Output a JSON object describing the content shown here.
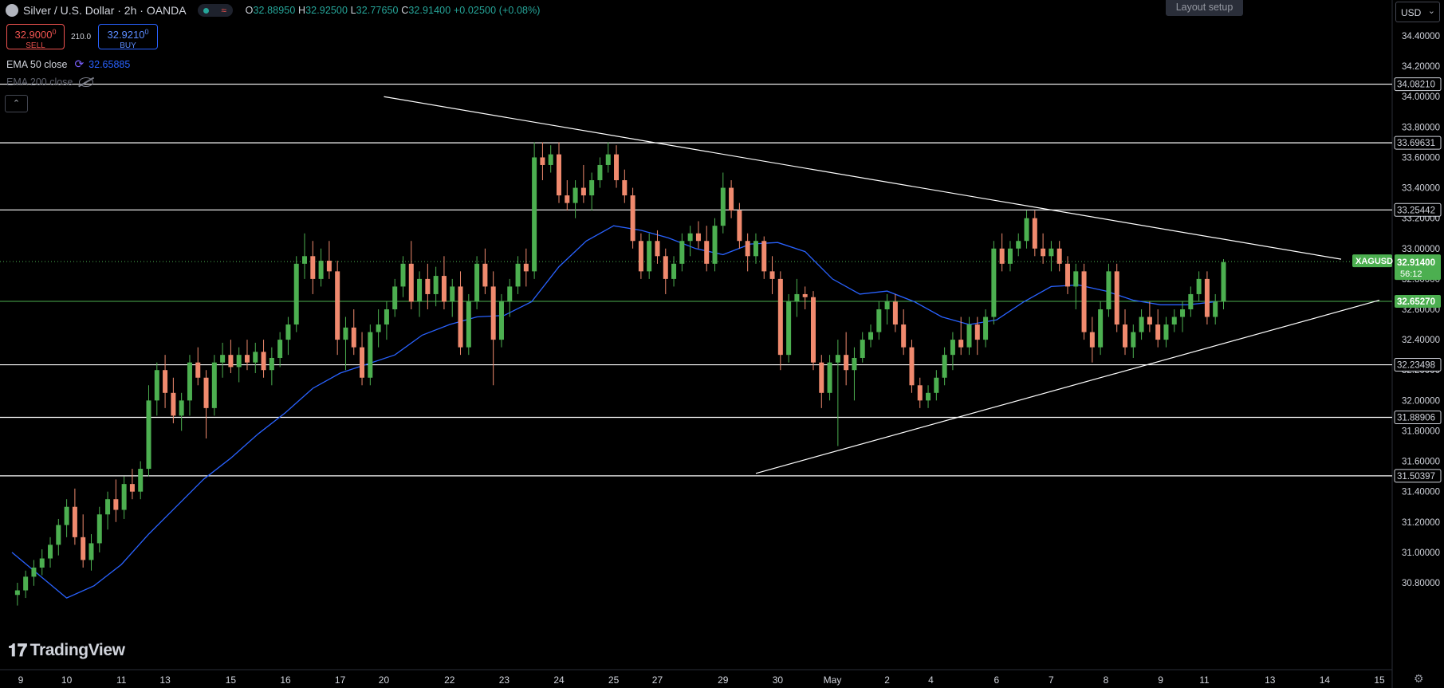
{
  "header": {
    "symbol": "Silver / U.S. Dollar · 2h · OANDA",
    "ohlc": {
      "o": "32.88950",
      "h": "32.92500",
      "l": "32.77650",
      "c": "32.91400",
      "change": "+0.02500 (+0.08%)"
    }
  },
  "trade": {
    "sell_price": "32.9000",
    "sell_sup": "0",
    "sell_label": "SELL",
    "spread": "210.0",
    "buy_price": "32.9210",
    "buy_sup": "0",
    "buy_label": "BUY"
  },
  "indicators": {
    "ema50_label": "EMA 50 close",
    "ema50_value": "32.65885",
    "ema200_label": "EMA 200 close"
  },
  "toolbar": {
    "layout_setup": "Layout setup",
    "currency": "USD"
  },
  "branding": {
    "name": "TradingView"
  },
  "colors": {
    "up": "#26a69a",
    "up_candle": "#4caf50",
    "down": "#ef5350",
    "down_candle": "#f08a6e",
    "ema": "#2962ff",
    "background": "#000000",
    "line": "#ffffff"
  },
  "chart_data": {
    "type": "candlestick",
    "ylim": [
      30.72,
      34.55
    ],
    "y_ticks": [
      "34.40000",
      "34.20000",
      "34.00000",
      "33.80000",
      "33.60000",
      "33.40000",
      "33.20000",
      "33.00000",
      "32.80000",
      "32.60000",
      "32.40000",
      "32.20000",
      "32.00000",
      "31.80000",
      "31.60000",
      "31.40000",
      "31.20000",
      "31.00000",
      "30.80000"
    ],
    "x_ticks": [
      {
        "label": "9",
        "x": 0.16
      },
      {
        "label": "10",
        "x": 1
      },
      {
        "label": "11",
        "x": 2
      },
      {
        "label": "13",
        "x": 2.8
      },
      {
        "label": "15",
        "x": 4
      },
      {
        "label": "16",
        "x": 5
      },
      {
        "label": "17",
        "x": 6
      },
      {
        "label": "20",
        "x": 6.8
      },
      {
        "label": "22",
        "x": 8
      },
      {
        "label": "23",
        "x": 9
      },
      {
        "label": "24",
        "x": 10
      },
      {
        "label": "25",
        "x": 11
      },
      {
        "label": "27",
        "x": 11.8
      },
      {
        "label": "29",
        "x": 13
      },
      {
        "label": "30",
        "x": 14
      },
      {
        "label": "May",
        "x": 15
      },
      {
        "label": "2",
        "x": 16
      },
      {
        "label": "4",
        "x": 16.8
      },
      {
        "label": "6",
        "x": 18
      },
      {
        "label": "7",
        "x": 19
      },
      {
        "label": "8",
        "x": 20
      },
      {
        "label": "9",
        "x": 21
      },
      {
        "label": "11",
        "x": 21.8
      },
      {
        "label": "13",
        "x": 23
      },
      {
        "label": "14",
        "x": 24
      },
      {
        "label": "15",
        "x": 25
      }
    ],
    "horizontal_levels": [
      {
        "value": 34.0821,
        "label": "34.08210"
      },
      {
        "value": 33.69631,
        "label": "33.69631"
      },
      {
        "value": 33.25442,
        "label": "33.25442"
      },
      {
        "value": 32.23498,
        "label": "32.23498"
      },
      {
        "value": 31.88906,
        "label": "31.88906"
      },
      {
        "value": 31.50397,
        "label": "31.50397"
      }
    ],
    "support_level": {
      "value": 32.6527,
      "label": "32.65270"
    },
    "current_price": {
      "symbol": "XAGUSD",
      "value": 32.914,
      "label": "32.91400",
      "countdown": "56:12"
    },
    "trendlines": [
      {
        "x1": 6.8,
        "y1": 34.0,
        "x2": 24.3,
        "y2": 32.93
      },
      {
        "x1": 13.6,
        "y1": 31.52,
        "x2": 25.0,
        "y2": 32.66
      }
    ],
    "ema50": [
      [
        0,
        31.0
      ],
      [
        0.5,
        30.85
      ],
      [
        1.0,
        30.7
      ],
      [
        1.5,
        30.78
      ],
      [
        2.0,
        30.92
      ],
      [
        2.5,
        31.12
      ],
      [
        3.0,
        31.3
      ],
      [
        3.5,
        31.48
      ],
      [
        4.0,
        31.62
      ],
      [
        4.5,
        31.78
      ],
      [
        5.0,
        31.92
      ],
      [
        5.5,
        32.08
      ],
      [
        6.0,
        32.18
      ],
      [
        6.5,
        32.24
      ],
      [
        7.0,
        32.3
      ],
      [
        7.5,
        32.43
      ],
      [
        8.0,
        32.5
      ],
      [
        8.5,
        32.55
      ],
      [
        9.0,
        32.56
      ],
      [
        9.5,
        32.65
      ],
      [
        10.0,
        32.88
      ],
      [
        10.5,
        33.05
      ],
      [
        11.0,
        33.15
      ],
      [
        11.5,
        33.12
      ],
      [
        12.0,
        33.07
      ],
      [
        12.5,
        33.0
      ],
      [
        13.0,
        32.96
      ],
      [
        13.5,
        33.03
      ],
      [
        14.0,
        33.04
      ],
      [
        14.5,
        32.98
      ],
      [
        15.0,
        32.8
      ],
      [
        15.5,
        32.7
      ],
      [
        16.0,
        32.72
      ],
      [
        16.5,
        32.65
      ],
      [
        17.0,
        32.55
      ],
      [
        17.5,
        32.5
      ],
      [
        18.0,
        32.53
      ],
      [
        18.5,
        32.65
      ],
      [
        19.0,
        32.75
      ],
      [
        19.5,
        32.76
      ],
      [
        20.0,
        32.72
      ],
      [
        20.5,
        32.66
      ],
      [
        21.0,
        32.63
      ],
      [
        21.5,
        32.63
      ],
      [
        22.0,
        32.65
      ]
    ],
    "candles": [
      [
        0.1,
        30.72,
        30.8,
        30.65,
        30.75
      ],
      [
        0.25,
        30.75,
        30.88,
        30.7,
        30.84
      ],
      [
        0.4,
        30.84,
        30.95,
        30.78,
        30.9
      ],
      [
        0.55,
        30.9,
        31.02,
        30.85,
        30.96
      ],
      [
        0.7,
        30.96,
        31.1,
        30.9,
        31.05
      ],
      [
        0.85,
        31.05,
        31.22,
        30.98,
        31.18
      ],
      [
        1.0,
        31.18,
        31.35,
        31.1,
        31.3
      ],
      [
        1.15,
        31.3,
        31.42,
        31.05,
        31.1
      ],
      [
        1.3,
        31.1,
        31.25,
        30.9,
        30.95
      ],
      [
        1.45,
        30.95,
        31.12,
        30.88,
        31.06
      ],
      [
        1.6,
        31.06,
        31.3,
        31.0,
        31.25
      ],
      [
        1.75,
        31.25,
        31.4,
        31.15,
        31.35
      ],
      [
        1.9,
        31.35,
        31.48,
        31.2,
        31.28
      ],
      [
        2.05,
        31.28,
        31.5,
        31.22,
        31.45
      ],
      [
        2.2,
        31.45,
        31.55,
        31.35,
        31.4
      ],
      [
        2.35,
        31.4,
        31.6,
        31.35,
        31.55
      ],
      [
        2.5,
        31.55,
        32.1,
        31.5,
        32.0
      ],
      [
        2.65,
        32.0,
        32.25,
        31.9,
        32.2
      ],
      [
        2.8,
        32.2,
        32.3,
        31.95,
        32.05
      ],
      [
        2.95,
        32.05,
        32.15,
        31.85,
        31.9
      ],
      [
        3.1,
        31.9,
        32.05,
        31.8,
        32.0
      ],
      [
        3.25,
        32.0,
        32.3,
        31.9,
        32.25
      ],
      [
        3.4,
        32.25,
        32.35,
        32.1,
        32.15
      ],
      [
        3.55,
        32.15,
        32.2,
        31.75,
        31.95
      ],
      [
        3.7,
        31.95,
        32.3,
        31.9,
        32.25
      ],
      [
        3.85,
        32.25,
        32.38,
        32.15,
        32.3
      ],
      [
        4.0,
        32.3,
        32.4,
        32.18,
        32.22
      ],
      [
        4.15,
        32.22,
        32.35,
        32.12,
        32.3
      ],
      [
        4.3,
        32.3,
        32.4,
        32.2,
        32.25
      ],
      [
        4.45,
        32.25,
        32.38,
        32.18,
        32.32
      ],
      [
        4.6,
        32.32,
        32.4,
        32.15,
        32.2
      ],
      [
        4.75,
        32.2,
        32.35,
        32.1,
        32.28
      ],
      [
        4.9,
        32.28,
        32.45,
        32.22,
        32.4
      ],
      [
        5.05,
        32.4,
        32.55,
        32.3,
        32.5
      ],
      [
        5.2,
        32.5,
        32.95,
        32.45,
        32.9
      ],
      [
        5.35,
        32.9,
        33.1,
        32.8,
        32.95
      ],
      [
        5.5,
        32.95,
        33.05,
        32.7,
        32.8
      ],
      [
        5.65,
        32.8,
        33.0,
        32.75,
        32.92
      ],
      [
        5.8,
        32.92,
        33.05,
        32.8,
        32.85
      ],
      [
        5.95,
        32.85,
        32.92,
        32.3,
        32.4
      ],
      [
        6.1,
        32.4,
        32.55,
        32.2,
        32.48
      ],
      [
        6.25,
        32.48,
        32.6,
        32.3,
        32.35
      ],
      [
        6.4,
        32.35,
        32.45,
        32.1,
        32.15
      ],
      [
        6.55,
        32.15,
        32.5,
        32.1,
        32.45
      ],
      [
        6.7,
        32.45,
        32.6,
        32.35,
        32.5
      ],
      [
        6.85,
        32.5,
        32.65,
        32.4,
        32.6
      ],
      [
        7.0,
        32.6,
        32.8,
        32.55,
        32.75
      ],
      [
        7.15,
        32.75,
        32.95,
        32.68,
        32.9
      ],
      [
        7.3,
        32.9,
        33.05,
        32.6,
        32.65
      ],
      [
        7.45,
        32.65,
        32.85,
        32.55,
        32.8
      ],
      [
        7.6,
        32.8,
        32.9,
        32.6,
        32.7
      ],
      [
        7.75,
        32.7,
        32.88,
        32.62,
        32.82
      ],
      [
        7.9,
        32.82,
        32.95,
        32.6,
        32.65
      ],
      [
        8.05,
        32.65,
        32.8,
        32.55,
        32.75
      ],
      [
        8.2,
        32.75,
        32.85,
        32.3,
        32.35
      ],
      [
        8.35,
        32.35,
        32.7,
        32.3,
        32.65
      ],
      [
        8.5,
        32.65,
        32.95,
        32.6,
        32.9
      ],
      [
        8.65,
        32.9,
        33.0,
        32.7,
        32.75
      ],
      [
        8.8,
        32.75,
        32.85,
        32.1,
        32.4
      ],
      [
        8.95,
        32.4,
        32.7,
        32.35,
        32.65
      ],
      [
        9.1,
        32.65,
        32.8,
        32.55,
        32.75
      ],
      [
        9.25,
        32.75,
        32.95,
        32.7,
        32.9
      ],
      [
        9.4,
        32.9,
        33.0,
        32.75,
        32.85
      ],
      [
        9.55,
        32.85,
        33.7,
        32.8,
        33.6
      ],
      [
        9.7,
        33.6,
        33.7,
        33.45,
        33.55
      ],
      [
        9.85,
        33.55,
        33.68,
        33.5,
        33.62
      ],
      [
        10.0,
        33.62,
        33.7,
        33.3,
        33.35
      ],
      [
        10.15,
        33.35,
        33.45,
        33.25,
        33.3
      ],
      [
        10.3,
        33.3,
        33.45,
        33.2,
        33.4
      ],
      [
        10.45,
        33.4,
        33.55,
        33.3,
        33.35
      ],
      [
        10.6,
        33.35,
        33.5,
        33.25,
        33.45
      ],
      [
        10.75,
        33.45,
        33.6,
        33.4,
        33.55
      ],
      [
        10.9,
        33.55,
        33.7,
        33.5,
        33.62
      ],
      [
        11.05,
        33.62,
        33.68,
        33.4,
        33.45
      ],
      [
        11.2,
        33.45,
        33.52,
        33.3,
        33.35
      ],
      [
        11.35,
        33.35,
        33.4,
        33.0,
        33.05
      ],
      [
        11.5,
        33.05,
        33.1,
        32.8,
        32.85
      ],
      [
        11.65,
        32.85,
        33.1,
        32.8,
        33.05
      ],
      [
        11.8,
        33.05,
        33.12,
        32.9,
        32.95
      ],
      [
        11.95,
        32.95,
        33.0,
        32.7,
        32.8
      ],
      [
        12.1,
        32.8,
        32.95,
        32.75,
        32.9
      ],
      [
        12.25,
        32.9,
        33.1,
        32.85,
        33.05
      ],
      [
        12.4,
        33.05,
        33.15,
        32.95,
        33.1
      ],
      [
        12.55,
        33.1,
        33.18,
        33.0,
        33.05
      ],
      [
        12.7,
        33.05,
        33.15,
        32.85,
        32.9
      ],
      [
        12.85,
        32.9,
        33.2,
        32.85,
        33.15
      ],
      [
        13.0,
        33.15,
        33.5,
        33.1,
        33.4
      ],
      [
        13.15,
        33.4,
        33.45,
        33.2,
        33.25
      ],
      [
        13.3,
        33.25,
        33.3,
        33.0,
        33.05
      ],
      [
        13.45,
        33.05,
        33.1,
        32.85,
        32.95
      ],
      [
        13.6,
        32.95,
        33.1,
        32.9,
        33.05
      ],
      [
        13.75,
        33.05,
        33.08,
        32.8,
        32.85
      ],
      [
        13.9,
        32.85,
        32.95,
        32.7,
        32.8
      ],
      [
        14.05,
        32.8,
        32.85,
        32.2,
        32.3
      ],
      [
        14.2,
        32.3,
        32.7,
        32.25,
        32.65
      ],
      [
        14.35,
        32.65,
        32.8,
        32.55,
        32.7
      ],
      [
        14.5,
        32.7,
        32.75,
        32.6,
        32.68
      ],
      [
        14.65,
        32.68,
        32.72,
        32.2,
        32.25
      ],
      [
        14.8,
        32.25,
        32.3,
        31.95,
        32.05
      ],
      [
        14.95,
        32.05,
        32.3,
        32.0,
        32.25
      ],
      [
        15.1,
        32.25,
        32.4,
        31.7,
        32.3
      ],
      [
        15.25,
        32.3,
        32.45,
        32.1,
        32.2
      ],
      [
        15.4,
        32.2,
        32.35,
        32.0,
        32.28
      ],
      [
        15.55,
        32.28,
        32.45,
        32.25,
        32.4
      ],
      [
        15.7,
        32.4,
        32.5,
        32.35,
        32.45
      ],
      [
        15.85,
        32.45,
        32.65,
        32.4,
        32.6
      ],
      [
        16.0,
        32.6,
        32.7,
        32.5,
        32.65
      ],
      [
        16.15,
        32.65,
        32.7,
        32.45,
        32.5
      ],
      [
        16.3,
        32.5,
        32.6,
        32.3,
        32.35
      ],
      [
        16.45,
        32.35,
        32.4,
        32.05,
        32.1
      ],
      [
        16.6,
        32.1,
        32.15,
        31.95,
        32.0
      ],
      [
        16.75,
        32.0,
        32.1,
        31.95,
        32.05
      ],
      [
        16.9,
        32.05,
        32.2,
        32.0,
        32.15
      ],
      [
        17.05,
        32.15,
        32.35,
        32.1,
        32.3
      ],
      [
        17.2,
        32.3,
        32.45,
        32.2,
        32.4
      ],
      [
        17.35,
        32.4,
        32.55,
        32.3,
        32.35
      ],
      [
        17.5,
        32.35,
        32.55,
        32.3,
        32.5
      ],
      [
        17.65,
        32.5,
        32.55,
        32.3,
        32.4
      ],
      [
        17.8,
        32.4,
        32.6,
        32.35,
        32.55
      ],
      [
        17.95,
        32.55,
        33.05,
        32.5,
        33.0
      ],
      [
        18.1,
        33.0,
        33.1,
        32.85,
        32.9
      ],
      [
        18.25,
        32.9,
        33.05,
        32.85,
        33.0
      ],
      [
        18.4,
        33.0,
        33.1,
        32.95,
        33.05
      ],
      [
        18.55,
        33.05,
        33.25,
        33.0,
        33.2
      ],
      [
        18.7,
        33.2,
        33.25,
        32.95,
        33.0
      ],
      [
        18.85,
        33.0,
        33.1,
        32.9,
        32.95
      ],
      [
        19.0,
        32.95,
        33.05,
        32.85,
        33.0
      ],
      [
        19.15,
        33.0,
        33.05,
        32.85,
        32.9
      ],
      [
        19.3,
        32.9,
        32.95,
        32.7,
        32.75
      ],
      [
        19.45,
        32.75,
        32.9,
        32.6,
        32.85
      ],
      [
        19.6,
        32.85,
        32.9,
        32.4,
        32.45
      ],
      [
        19.75,
        32.45,
        32.55,
        32.25,
        32.35
      ],
      [
        19.9,
        32.35,
        32.65,
        32.3,
        32.6
      ],
      [
        20.05,
        32.6,
        32.9,
        32.55,
        32.85
      ],
      [
        20.2,
        32.85,
        32.9,
        32.45,
        32.5
      ],
      [
        20.35,
        32.5,
        32.6,
        32.3,
        32.35
      ],
      [
        20.5,
        32.35,
        32.5,
        32.28,
        32.45
      ],
      [
        20.65,
        32.45,
        32.6,
        32.4,
        32.55
      ],
      [
        20.8,
        32.55,
        32.65,
        32.45,
        32.5
      ],
      [
        20.95,
        32.5,
        32.6,
        32.35,
        32.4
      ],
      [
        21.1,
        32.4,
        32.55,
        32.35,
        32.5
      ],
      [
        21.25,
        32.5,
        32.6,
        32.45,
        32.55
      ],
      [
        21.4,
        32.55,
        32.65,
        32.45,
        32.6
      ],
      [
        21.55,
        32.6,
        32.75,
        32.55,
        32.7
      ],
      [
        21.7,
        32.7,
        32.85,
        32.65,
        32.8
      ],
      [
        21.85,
        32.8,
        32.85,
        32.5,
        32.55
      ],
      [
        22.0,
        32.55,
        32.7,
        32.5,
        32.65
      ],
      [
        22.15,
        32.65,
        32.93,
        32.6,
        32.91
      ]
    ]
  }
}
